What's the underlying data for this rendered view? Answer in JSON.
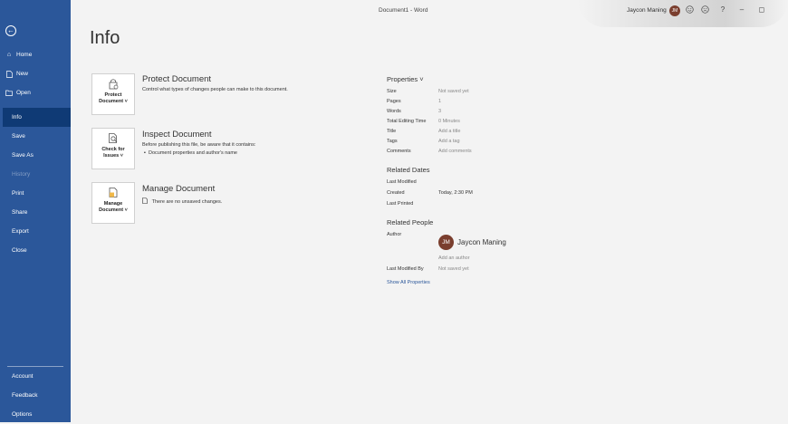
{
  "titlebar": {
    "doc_title": "Document1  -  Word",
    "user_name": "Jaycon Maning",
    "user_initials": "JM",
    "icons": [
      "smiley-icon",
      "frown-icon",
      "help-icon",
      "minimize-icon",
      "restore-icon"
    ],
    "help_glyph": "?",
    "minimize_glyph": "–",
    "restore_glyph": "◻"
  },
  "sidebar": {
    "back_glyph": "←",
    "top_items": [
      {
        "label": "Home",
        "icon": "home-icon"
      },
      {
        "label": "New",
        "icon": "new-document-icon"
      },
      {
        "label": "Open",
        "icon": "open-folder-icon"
      }
    ],
    "main_items": [
      {
        "label": "Info",
        "selected": true
      },
      {
        "label": "Save"
      },
      {
        "label": "Save As"
      },
      {
        "label": "History",
        "disabled": true
      },
      {
        "label": "Print"
      },
      {
        "label": "Share"
      },
      {
        "label": "Export"
      },
      {
        "label": "Close"
      }
    ],
    "bottom_items": [
      {
        "label": "Account"
      },
      {
        "label": "Feedback"
      },
      {
        "label": "Options"
      }
    ]
  },
  "main": {
    "title": "Info",
    "sections": [
      {
        "card_line1": "Protect",
        "card_line2": "Document ˅",
        "heading": "Protect Document",
        "description": "Control what types of changes people can make to this document."
      },
      {
        "card_line1": "Check for",
        "card_line2": "Issues ˅",
        "heading": "Inspect Document",
        "description": "Before publishing this file, be aware that it contains:",
        "bullet": "Document properties and author's name"
      },
      {
        "card_line1": "Manage",
        "card_line2": "Document ˅",
        "heading": "Manage Document",
        "description": "There are no unsaved changes."
      }
    ]
  },
  "properties": {
    "heading": "Properties ˅",
    "rows": [
      {
        "label": "Size",
        "value": "Not saved yet"
      },
      {
        "label": "Pages",
        "value": "1"
      },
      {
        "label": "Words",
        "value": "3"
      },
      {
        "label": "Total Editing Time",
        "value": "0 Minutes"
      },
      {
        "label": "Title",
        "value": "Add a title"
      },
      {
        "label": "Tags",
        "value": "Add a tag"
      },
      {
        "label": "Comments",
        "value": "Add comments"
      }
    ],
    "dates_heading": "Related Dates",
    "dates": [
      {
        "label": "Last Modified",
        "value": ""
      },
      {
        "label": "Created",
        "value": "Today, 2:30 PM"
      },
      {
        "label": "Last Printed",
        "value": ""
      }
    ],
    "people_heading": "Related People",
    "author_label": "Author",
    "author_initials": "JM",
    "author_name": "Jaycon Maning",
    "add_author": "Add an author",
    "last_modified_by_label": "Last Modified By",
    "last_modified_by_value": "Not saved yet",
    "show_all": "Show All Properties"
  }
}
